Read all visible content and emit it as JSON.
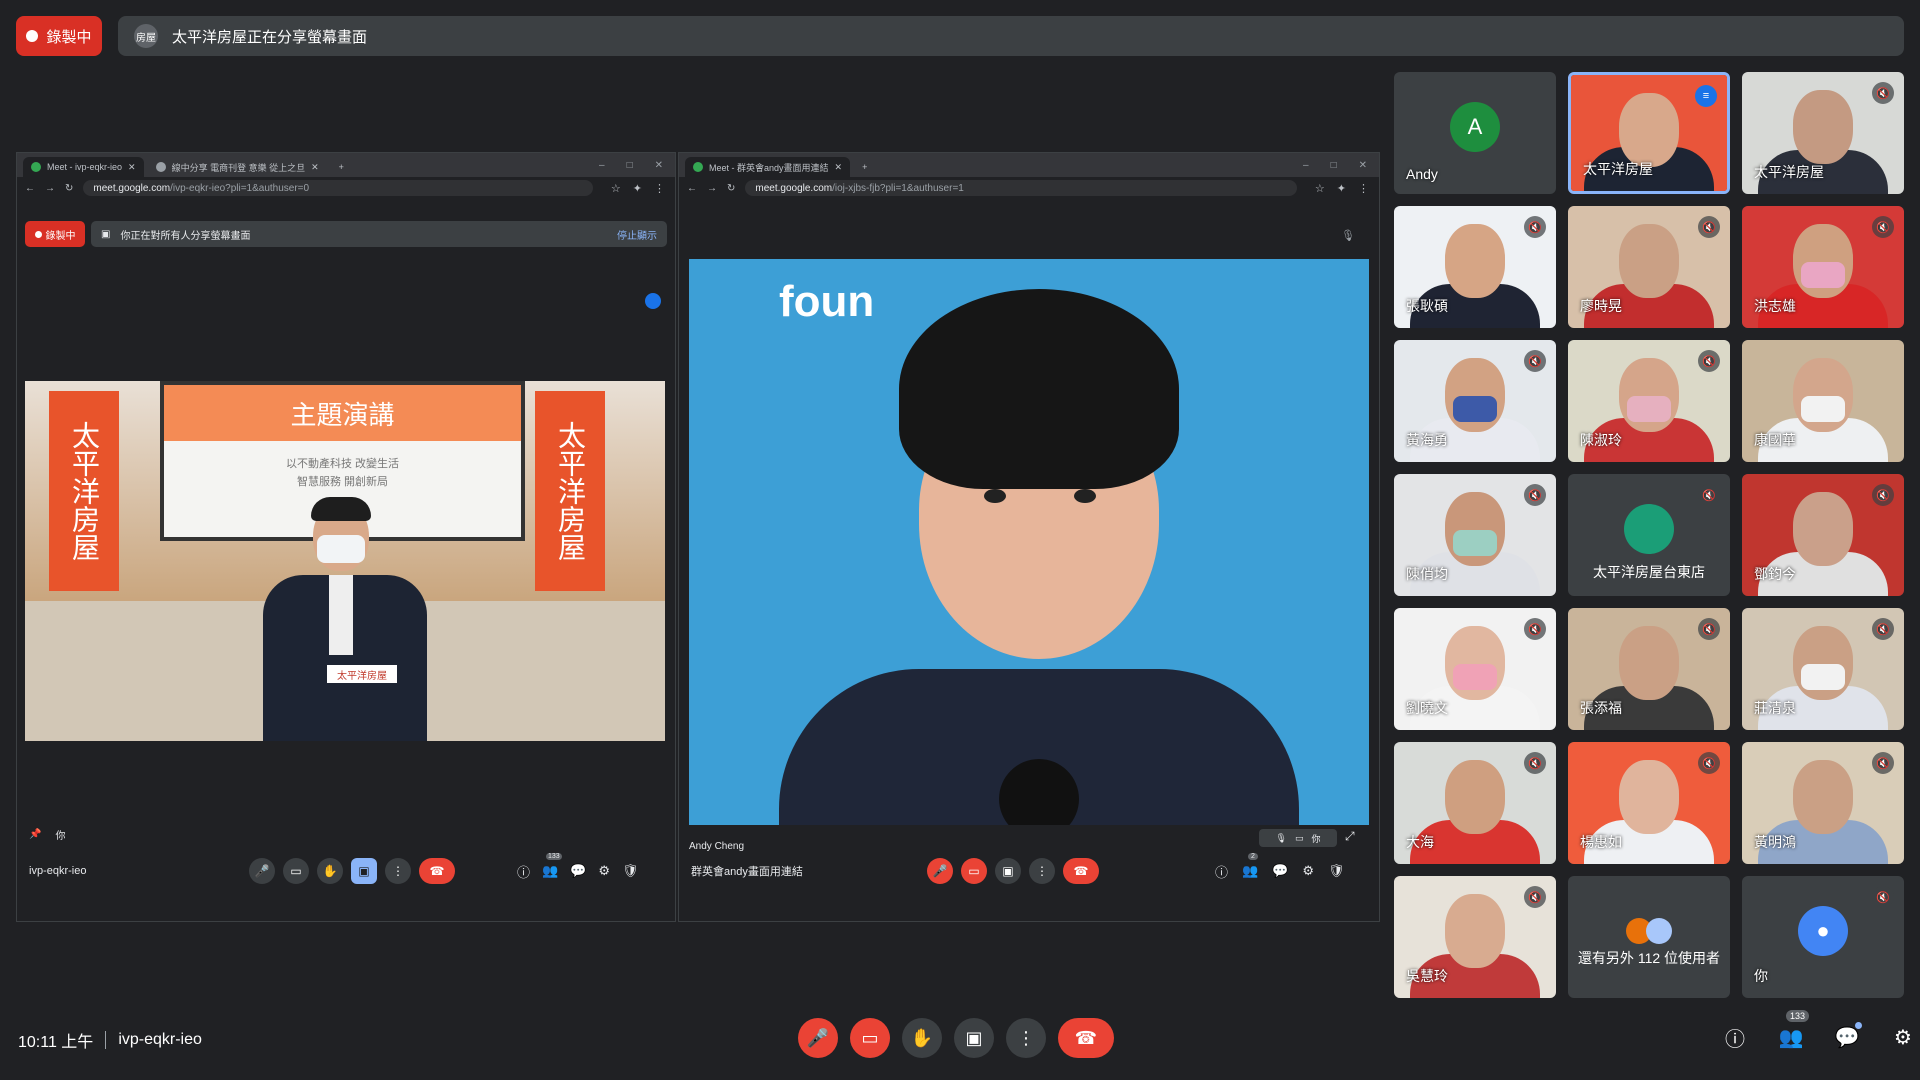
{
  "top": {
    "recording_label": "錄製中",
    "share_avatar_text": "房屋",
    "share_text": "太平洋房屋正在分享螢幕畫面"
  },
  "left_browser": {
    "tabs": [
      "Meet - ivp-eqkr-ieo",
      "線中分享 電商刊登 意樂 從上之旦"
    ],
    "url_host": "meet.google.com",
    "url_path": "/ivp-eqkr-ieo?pli=1&authuser=0",
    "inner_recording": "錄製中",
    "inner_share_text": "你正在對所有人分享螢幕畫面",
    "stop_label": "停止顯示",
    "projection_title": "主題演講",
    "projection_lines": [
      "以不動產科技 改變生活",
      "智慧服務 開創新局"
    ],
    "banner_text": "太平洋房屋",
    "podium_text": "太平洋房屋",
    "you_label": "你",
    "meeting_code": "ivp-eqkr-ieo",
    "participants_count": "133"
  },
  "right_browser": {
    "tabs": [
      "Meet - 群英會andy畫面用連結"
    ],
    "url_host": "meet.google.com",
    "url_path": "/ioj-xjbs-fjb?pli=1&authuser=1",
    "brand_text": "foun",
    "speaker_name": "Andy Cheng",
    "overlay_label": "你",
    "meeting_title": "群英會andy畫面用連結",
    "participants_count": "2"
  },
  "participants": [
    {
      "name": "Andy",
      "type": "avatar",
      "initial": "A",
      "color": "#1e8e3e",
      "muted": false
    },
    {
      "name": "太平洋房屋",
      "type": "video",
      "speaking": true,
      "muted": false,
      "bg": "#e9553a",
      "skin": "#d8a88b",
      "mask": "",
      "shirt": "#1d2433"
    },
    {
      "name": "太平洋房屋",
      "type": "video",
      "muted": true,
      "bg": "#d7d9d6",
      "skin": "#c49a82",
      "mask": "",
      "shirt": "#2b2f3a"
    },
    {
      "name": "張耿碩",
      "type": "video",
      "muted": true,
      "bg": "#eef1f4",
      "skin": "#d6a585",
      "mask": "",
      "shirt": "#1f2433"
    },
    {
      "name": "廖時晃",
      "type": "video",
      "muted": true,
      "bg": "#d7c0a9",
      "skin": "#caa085",
      "mask": "",
      "shirt": "#c22e2e"
    },
    {
      "name": "洪志雄",
      "type": "video",
      "muted": true,
      "bg": "#d43a37",
      "skin": "#cfa080",
      "mask": "#e9a6c3",
      "shirt": "#d82626"
    },
    {
      "name": "黃海勇",
      "type": "video",
      "muted": true,
      "bg": "#e4e8ec",
      "skin": "#d2a283",
      "mask": "#3d5aa8",
      "shirt": "#e8eaf0"
    },
    {
      "name": "陳淑玲",
      "type": "video",
      "muted": true,
      "bg": "#dbd9c8",
      "skin": "#d5a58a",
      "mask": "#e6b0bf",
      "shirt": "#c93535"
    },
    {
      "name": "康國華",
      "type": "video",
      "muted": false,
      "bg": "#c8b59a",
      "skin": "#d3a68c",
      "mask": "#f2f2f2",
      "shirt": "#eef0f2"
    },
    {
      "name": "陳俏均",
      "type": "video",
      "muted": true,
      "bg": "#e3e4e6",
      "skin": "#c9977a",
      "mask": "#9ccfc2",
      "shirt": "#dfe1e6"
    },
    {
      "name": "太平洋房屋台東店",
      "type": "avatar",
      "initial": "",
      "color": "#1b9e77",
      "muted": true
    },
    {
      "name": "鄧鈞今",
      "type": "video",
      "muted": true,
      "bg": "#c0362f",
      "skin": "#caa08a",
      "mask": "",
      "shirt": "#e0e0e0"
    },
    {
      "name": "劉曉文",
      "type": "video",
      "muted": true,
      "bg": "#f2f2f2",
      "skin": "#e1b7a0",
      "mask": "#f0a2b6",
      "shirt": "#f4f4f4"
    },
    {
      "name": "張添福",
      "type": "video",
      "muted": true,
      "bg": "#c9b49a",
      "skin": "#caa085",
      "mask": "",
      "shirt": "#3a3a3a"
    },
    {
      "name": "莊清泉",
      "type": "video",
      "muted": true,
      "bg": "#d2c6b4",
      "skin": "#caa085",
      "mask": "#f2f2f2",
      "shirt": "#e0e3ea"
    },
    {
      "name": "大海",
      "type": "video",
      "muted": true,
      "bg": "#d8dbd8",
      "skin": "#cf9f80",
      "mask": "",
      "shirt": "#d93530"
    },
    {
      "name": "楊惠如",
      "type": "video",
      "muted": true,
      "bg": "#ef5c3c",
      "skin": "#e0b49c",
      "mask": "",
      "shirt": "#eef0f3"
    },
    {
      "name": "黃明鴻",
      "type": "video",
      "muted": true,
      "bg": "#d9cdb8",
      "skin": "#caa085",
      "mask": "",
      "shirt": "#8fa6c8"
    },
    {
      "name": "吳慧玲",
      "type": "video",
      "muted": true,
      "bg": "#e7e2d9",
      "skin": "#d8ab90",
      "mask": "",
      "shirt": "#c03a3a"
    },
    {
      "name": "還有另外 112 位使用者",
      "type": "more",
      "muted": false
    },
    {
      "name": "你",
      "type": "avatar",
      "initial": "●",
      "color": "#4285f4",
      "muted": true
    }
  ],
  "bottom": {
    "time": "10:11 上午",
    "meeting_code": "ivp-eqkr-ieo",
    "participants_count": "133"
  }
}
